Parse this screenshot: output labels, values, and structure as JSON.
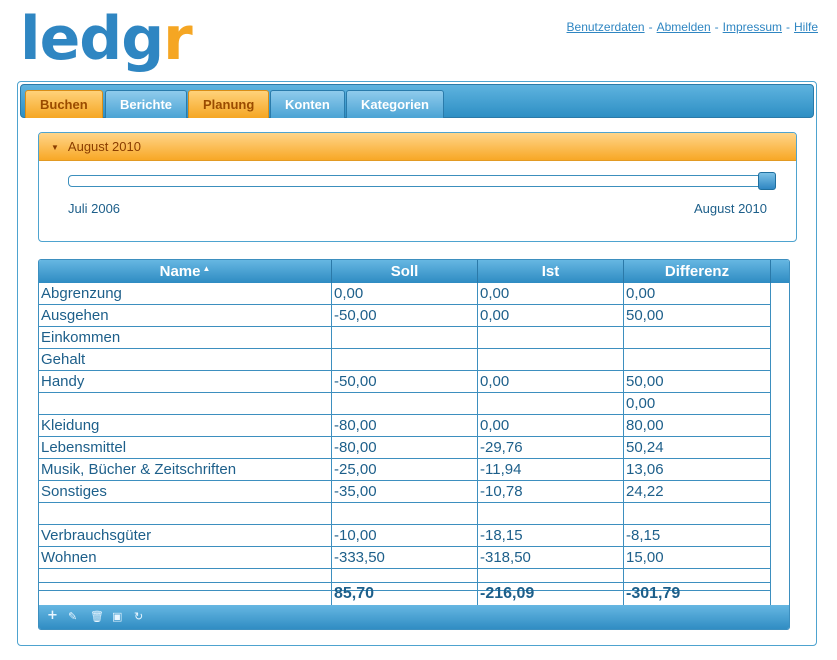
{
  "logo": {
    "part1": "ledg",
    "part2": "r"
  },
  "toplinks": [
    {
      "label": "Benutzerdaten"
    },
    {
      "label": "Abmelden"
    },
    {
      "label": "Impressum"
    },
    {
      "label": "Hilfe"
    }
  ],
  "toplinks_separator": "-",
  "tabs": [
    {
      "label": "Buchen",
      "style": "orange"
    },
    {
      "label": "Berichte",
      "style": "blue"
    },
    {
      "label": "Planung",
      "style": "orange"
    },
    {
      "label": "Konten",
      "style": "blue"
    },
    {
      "label": "Kategorien",
      "style": "blue"
    }
  ],
  "period": {
    "title": "August 2010",
    "range_start": "Juli 2006",
    "range_end": "August 2010",
    "slider_value_fraction": 1.0
  },
  "table": {
    "columns": [
      "Name",
      "Soll",
      "Ist",
      "Differenz"
    ],
    "sorted_column": "Name",
    "rows": [
      [
        "Abgrenzung",
        "0,00",
        "0,00",
        "0,00"
      ],
      [
        "Ausgehen",
        "-50,00",
        "0,00",
        "50,00"
      ],
      [
        "Einkommen",
        "",
        "",
        ""
      ],
      [
        "Gehalt",
        "",
        "",
        ""
      ],
      [
        "Handy",
        "-50,00",
        "0,00",
        "50,00"
      ],
      [
        "",
        "",
        "",
        "0,00"
      ],
      [
        "Kleidung",
        "-80,00",
        "0,00",
        "80,00"
      ],
      [
        "Lebensmittel",
        "-80,00",
        "-29,76",
        "50,24"
      ],
      [
        "Musik, Bücher & Zeitschriften",
        "-25,00",
        "-11,94",
        "13,06"
      ],
      [
        "Sonstiges",
        "-35,00",
        "-10,78",
        "24,22"
      ],
      [
        "",
        "",
        "",
        ""
      ],
      [
        "Verbrauchsgüter",
        "-10,00",
        "-18,15",
        "-8,15"
      ],
      [
        "Wohnen",
        "-333,50",
        "-318,50",
        "15,00"
      ],
      [
        "",
        "",
        "",
        ""
      ]
    ],
    "totals": [
      "",
      "85,70",
      "-216,09",
      "-301,79"
    ]
  },
  "footer_icons": [
    "add-icon",
    "edit-icon",
    "delete-icon",
    "image-icon",
    "refresh-icon"
  ],
  "colors": {
    "accent_blue": "#2f86c2",
    "accent_orange": "#f5a623"
  }
}
